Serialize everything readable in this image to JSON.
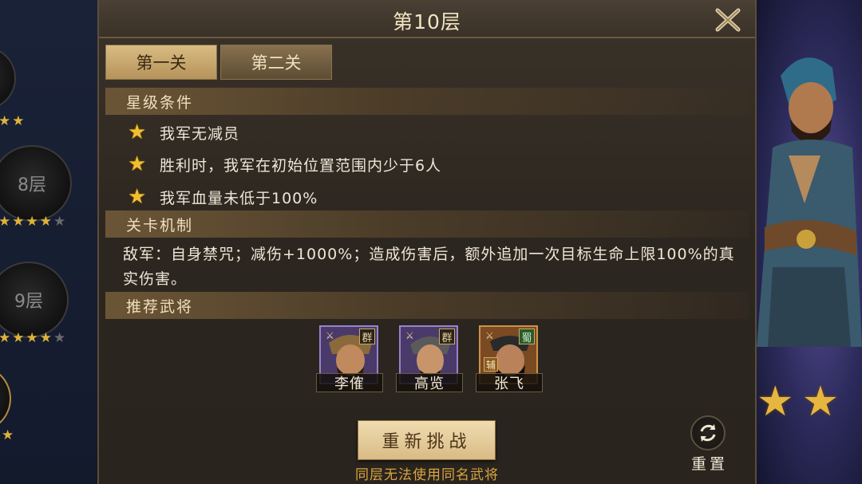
{
  "background": {
    "left_floors": [
      {
        "label": "",
        "stars_on": 2,
        "stars_total": 2
      },
      {
        "label": "8层",
        "stars_on": 4,
        "stars_total": 5
      },
      {
        "label": "9层",
        "stars_on": 4,
        "stars_total": 5
      }
    ],
    "right_stars": 2
  },
  "dialog": {
    "title": "第10层",
    "tabs": [
      {
        "label": "第一关",
        "active": true
      },
      {
        "label": "第二关",
        "active": false
      }
    ],
    "star_section": {
      "heading": "星级条件",
      "conditions": [
        "我军无减员",
        "胜利时，我军在初始位置范围内少于6人",
        "我军血量未低于100%"
      ]
    },
    "mechanic_section": {
      "heading": "关卡机制",
      "text": "敌军：自身禁咒；减伤+1000%；造成伤害后，额外追加一次目标生命上限100%的真实伤害。"
    },
    "recommend_section": {
      "heading": "推荐武将",
      "heroes": [
        {
          "name": "李傕",
          "faction": "群",
          "rarity": "purple"
        },
        {
          "name": "高览",
          "faction": "群",
          "rarity": "purple"
        },
        {
          "name": "张飞",
          "faction": "蜀",
          "rarity": "orange",
          "role": "辅"
        }
      ]
    },
    "retry_button": "重新挑战",
    "hint": "同层无法使用同名武将",
    "reset_label": "重置"
  },
  "colors": {
    "star_gold": "#f1bf2e",
    "hint_gold": "#d9a53e",
    "panel_bg": "#2c2620"
  }
}
